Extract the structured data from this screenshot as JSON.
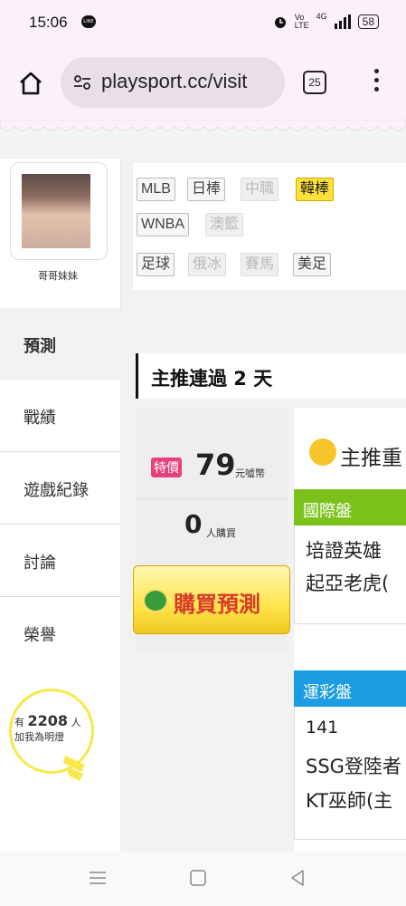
{
  "status_bar": {
    "time": "15:06",
    "network": "4G",
    "battery": "58"
  },
  "browser": {
    "url": "playsport.cc/visit",
    "tab_count": "25"
  },
  "profile": {
    "name": "哥哥妹妹"
  },
  "nav": [
    "預測",
    "戰績",
    "遊戲紀錄",
    "討論",
    "榮譽"
  ],
  "light": {
    "prefix": "有",
    "count": "2208",
    "suffix": "人",
    "caption": "加我為明燈"
  },
  "tags": [
    {
      "label": "MLB",
      "state": "normal"
    },
    {
      "label": "日棒",
      "state": "normal"
    },
    {
      "label": "中職",
      "state": "dim"
    },
    {
      "label": "韓棒",
      "state": "active"
    },
    {
      "label": "WNBA",
      "state": "normal"
    },
    {
      "label": "澳籃",
      "state": "dim"
    },
    {
      "label": "足球",
      "state": "normal"
    },
    {
      "label": "俄冰",
      "state": "dim"
    },
    {
      "label": "賽馬",
      "state": "dim"
    },
    {
      "label": "美足",
      "state": "normal"
    }
  ],
  "section": {
    "title": "主推連過 2 天"
  },
  "price": {
    "badge": "特價",
    "amount": "79",
    "unit": "元噓幣",
    "buyers": "0",
    "buyers_label": "人購買",
    "buy_button": "購買預測"
  },
  "headline": "主推重",
  "international": {
    "header": "國際盤",
    "lines": [
      "培證英雄",
      "起亞老虎("
    ]
  },
  "taiwan_lottery": {
    "header": "運彩盤",
    "lines": [
      "141",
      "SSG登陸者",
      "KT巫師(主"
    ]
  },
  "colors": {
    "active_tag": "#ffe13b",
    "intl": "#7cc21c",
    "lottery": "#1c9ce2",
    "special": "#e6417c",
    "buy_text": "#d83a2a"
  }
}
